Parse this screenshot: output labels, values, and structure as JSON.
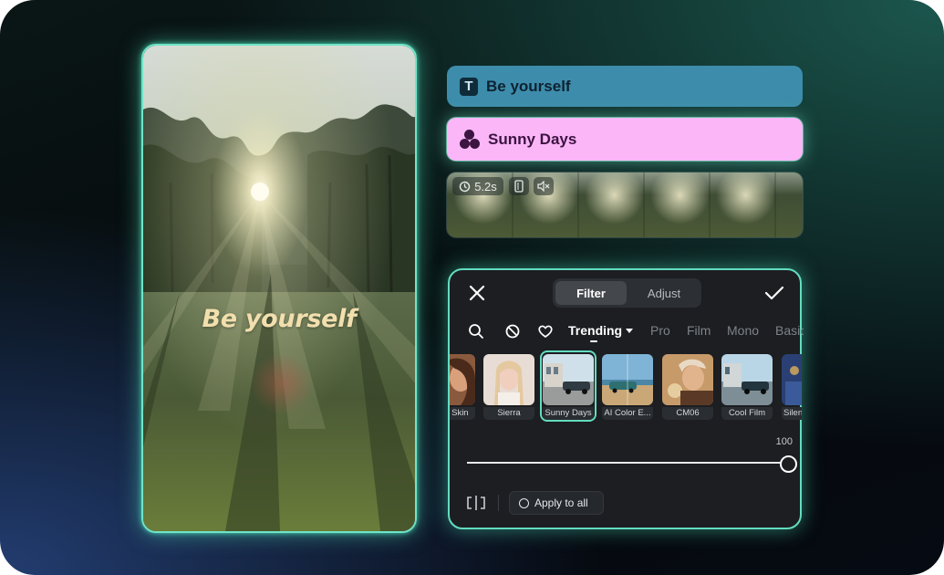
{
  "preview": {
    "overlay_text": "Be yourself"
  },
  "tracks": {
    "text_track": {
      "icon": "text-t-icon",
      "label": "Be yourself",
      "color": "#3d8cab"
    },
    "filter_track": {
      "icon": "filter-circles-icon",
      "label": "Sunny Days",
      "color": "#fbb6f8"
    },
    "video_track": {
      "duration": "5.2s",
      "icons": [
        "timer-icon",
        "phone-frame-icon",
        "mute-icon"
      ]
    }
  },
  "filter_panel": {
    "tabs": [
      {
        "label": "Filter",
        "active": true
      },
      {
        "label": "Adjust",
        "active": false
      }
    ],
    "categories": [
      {
        "label": "Trending",
        "active": true
      },
      {
        "label": "Pro"
      },
      {
        "label": "Film"
      },
      {
        "label": "Mono"
      },
      {
        "label": "Basic"
      }
    ],
    "filters": [
      {
        "label": "Pure Skin"
      },
      {
        "label": "Sierra"
      },
      {
        "label": "Sunny Days",
        "selected": true
      },
      {
        "label": "AI Color E..."
      },
      {
        "label": "CM06"
      },
      {
        "label": "Cool Film"
      },
      {
        "label": "Silent"
      }
    ],
    "intensity_value": "100",
    "intensity_fraction": 1.0,
    "apply_all_label": "Apply to all",
    "accent_color": "#63dcc0"
  }
}
